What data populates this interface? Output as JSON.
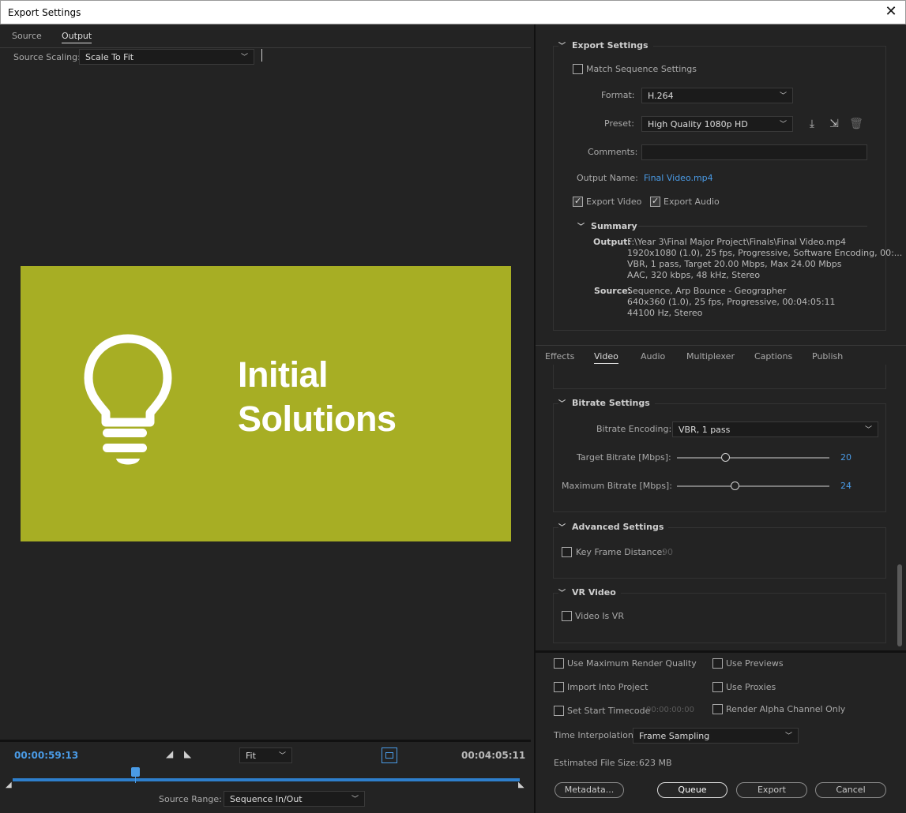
{
  "window": {
    "title": "Export Settings",
    "close": "✕"
  },
  "left": {
    "tabs": [
      "Source",
      "Output"
    ],
    "source_scaling_label": "Source Scaling:",
    "source_scaling_value": "Scale To Fit",
    "preview": {
      "line1": "Initial",
      "line2": "Solutions",
      "bg_color": "#a7ae24"
    },
    "timeline": {
      "current_tc": "00:00:59:13",
      "end_tc": "00:04:05:11",
      "zoom": "Fit",
      "source_range_label": "Source Range:",
      "source_range_value": "Sequence In/Out"
    }
  },
  "export": {
    "section": "Export Settings",
    "match_sequence": "Match Sequence Settings",
    "format_label": "Format:",
    "format_value": "H.264",
    "preset_label": "Preset:",
    "preset_value": "High Quality 1080p HD",
    "comments_label": "Comments:",
    "output_name_label": "Output Name:",
    "output_name_value": "Final Video.mp4",
    "export_video": "Export Video",
    "export_audio": "Export Audio",
    "summary_title": "Summary",
    "output_label": "Output:",
    "output_lines": [
      "F:\\Year 3\\Final Major Project\\Finals\\Final Video.mp4",
      "1920x1080 (1.0), 25 fps, Progressive, Software Encoding, 00:...",
      "VBR, 1 pass, Target 20.00 Mbps, Max 24.00 Mbps",
      "AAC, 320 kbps, 48 kHz, Stereo"
    ],
    "source_label": "Source:",
    "source_lines": [
      "Sequence, Arp Bounce - Geographer",
      "640x360 (1.0), 25 fps, Progressive, 00:04:05:11",
      "44100 Hz, Stereo"
    ]
  },
  "subtabs": [
    "Effects",
    "Video",
    "Audio",
    "Multiplexer",
    "Captions",
    "Publish"
  ],
  "bitrate": {
    "section": "Bitrate Settings",
    "encoding_label": "Bitrate Encoding:",
    "encoding_value": "VBR, 1 pass",
    "target_label": "Target Bitrate [Mbps]:",
    "target_value": "20",
    "max_label": "Maximum Bitrate [Mbps]:",
    "max_value": "24"
  },
  "advanced": {
    "section": "Advanced Settings",
    "key_frame": "Key Frame Distance:",
    "key_frame_value": "90"
  },
  "vr": {
    "section": "VR Video",
    "video_is_vr": "Video Is VR"
  },
  "bottom": {
    "use_max_render": "Use Maximum Render Quality",
    "use_previews": "Use Previews",
    "import_into_project": "Import Into Project",
    "use_proxies": "Use Proxies",
    "set_start_tc": "Set Start Timecode",
    "start_tc_value": "00:00:00:00",
    "render_alpha": "Render Alpha Channel Only",
    "time_interp_label": "Time Interpolation:",
    "time_interp_value": "Frame Sampling",
    "est_size_label": "Estimated File Size:",
    "est_size_value": "623 MB",
    "metadata": "Metadata...",
    "queue": "Queue",
    "export": "Export",
    "cancel": "Cancel"
  }
}
